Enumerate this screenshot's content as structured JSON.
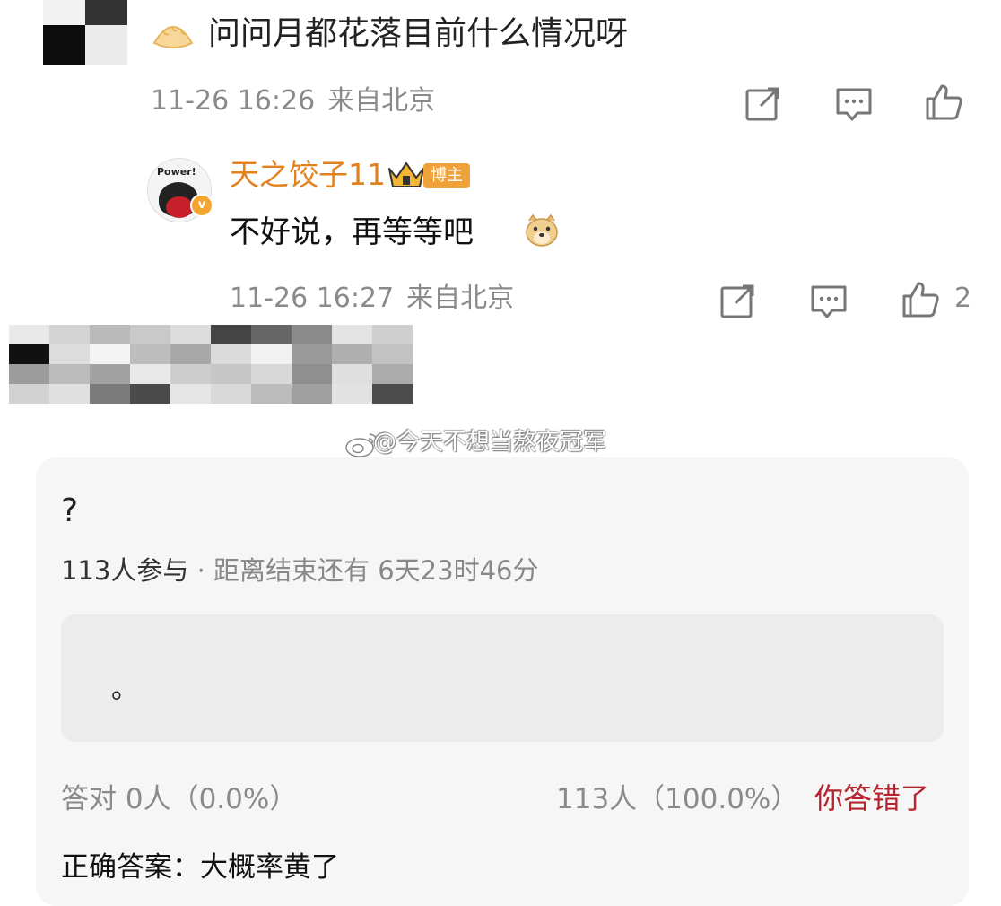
{
  "comment": {
    "text": "问问月都花落目前什么情况呀",
    "time": "11-26 16:26",
    "location": "来自北京",
    "share_icon": "share-icon",
    "reply_icon": "comment-icon",
    "like_icon": "thumbs-up-icon"
  },
  "reply": {
    "username": "天之饺子11",
    "badge": "博主",
    "avatar_text": "Power!",
    "text": "不好说，再等等吧",
    "time": "11-26 16:27",
    "location": "来自北京",
    "like_count": "2"
  },
  "watermark": {
    "text": "@今天不想当熬夜冠军"
  },
  "quiz": {
    "question": "?",
    "participants": "113人参与",
    "separator": "·",
    "remaining": "距离结束还有 6天23时46分",
    "option": "。",
    "correct_stat": "答对 0人（0.0%）",
    "wrong_stat": "113人（100.0%）",
    "result": "你答错了",
    "answer": "正确答案：大概率黄了"
  },
  "colors": {
    "username": "#e2821f",
    "badge": "#f0a23a",
    "wrong": "#b3262f",
    "meta": "#8a8a8a",
    "card": "#f6f6f6"
  }
}
